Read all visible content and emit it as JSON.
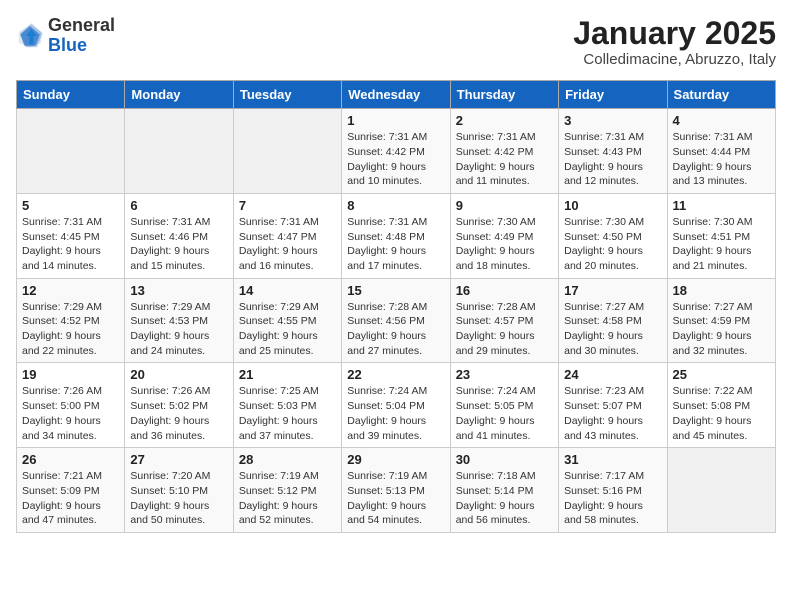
{
  "header": {
    "logo_general": "General",
    "logo_blue": "Blue",
    "title": "January 2025",
    "subtitle": "Colledimacine, Abruzzo, Italy"
  },
  "days_of_week": [
    "Sunday",
    "Monday",
    "Tuesday",
    "Wednesday",
    "Thursday",
    "Friday",
    "Saturday"
  ],
  "weeks": [
    [
      {
        "day": "",
        "info": ""
      },
      {
        "day": "",
        "info": ""
      },
      {
        "day": "",
        "info": ""
      },
      {
        "day": "1",
        "info": "Sunrise: 7:31 AM\nSunset: 4:42 PM\nDaylight: 9 hours\nand 10 minutes."
      },
      {
        "day": "2",
        "info": "Sunrise: 7:31 AM\nSunset: 4:42 PM\nDaylight: 9 hours\nand 11 minutes."
      },
      {
        "day": "3",
        "info": "Sunrise: 7:31 AM\nSunset: 4:43 PM\nDaylight: 9 hours\nand 12 minutes."
      },
      {
        "day": "4",
        "info": "Sunrise: 7:31 AM\nSunset: 4:44 PM\nDaylight: 9 hours\nand 13 minutes."
      }
    ],
    [
      {
        "day": "5",
        "info": "Sunrise: 7:31 AM\nSunset: 4:45 PM\nDaylight: 9 hours\nand 14 minutes."
      },
      {
        "day": "6",
        "info": "Sunrise: 7:31 AM\nSunset: 4:46 PM\nDaylight: 9 hours\nand 15 minutes."
      },
      {
        "day": "7",
        "info": "Sunrise: 7:31 AM\nSunset: 4:47 PM\nDaylight: 9 hours\nand 16 minutes."
      },
      {
        "day": "8",
        "info": "Sunrise: 7:31 AM\nSunset: 4:48 PM\nDaylight: 9 hours\nand 17 minutes."
      },
      {
        "day": "9",
        "info": "Sunrise: 7:30 AM\nSunset: 4:49 PM\nDaylight: 9 hours\nand 18 minutes."
      },
      {
        "day": "10",
        "info": "Sunrise: 7:30 AM\nSunset: 4:50 PM\nDaylight: 9 hours\nand 20 minutes."
      },
      {
        "day": "11",
        "info": "Sunrise: 7:30 AM\nSunset: 4:51 PM\nDaylight: 9 hours\nand 21 minutes."
      }
    ],
    [
      {
        "day": "12",
        "info": "Sunrise: 7:29 AM\nSunset: 4:52 PM\nDaylight: 9 hours\nand 22 minutes."
      },
      {
        "day": "13",
        "info": "Sunrise: 7:29 AM\nSunset: 4:53 PM\nDaylight: 9 hours\nand 24 minutes."
      },
      {
        "day": "14",
        "info": "Sunrise: 7:29 AM\nSunset: 4:55 PM\nDaylight: 9 hours\nand 25 minutes."
      },
      {
        "day": "15",
        "info": "Sunrise: 7:28 AM\nSunset: 4:56 PM\nDaylight: 9 hours\nand 27 minutes."
      },
      {
        "day": "16",
        "info": "Sunrise: 7:28 AM\nSunset: 4:57 PM\nDaylight: 9 hours\nand 29 minutes."
      },
      {
        "day": "17",
        "info": "Sunrise: 7:27 AM\nSunset: 4:58 PM\nDaylight: 9 hours\nand 30 minutes."
      },
      {
        "day": "18",
        "info": "Sunrise: 7:27 AM\nSunset: 4:59 PM\nDaylight: 9 hours\nand 32 minutes."
      }
    ],
    [
      {
        "day": "19",
        "info": "Sunrise: 7:26 AM\nSunset: 5:00 PM\nDaylight: 9 hours\nand 34 minutes."
      },
      {
        "day": "20",
        "info": "Sunrise: 7:26 AM\nSunset: 5:02 PM\nDaylight: 9 hours\nand 36 minutes."
      },
      {
        "day": "21",
        "info": "Sunrise: 7:25 AM\nSunset: 5:03 PM\nDaylight: 9 hours\nand 37 minutes."
      },
      {
        "day": "22",
        "info": "Sunrise: 7:24 AM\nSunset: 5:04 PM\nDaylight: 9 hours\nand 39 minutes."
      },
      {
        "day": "23",
        "info": "Sunrise: 7:24 AM\nSunset: 5:05 PM\nDaylight: 9 hours\nand 41 minutes."
      },
      {
        "day": "24",
        "info": "Sunrise: 7:23 AM\nSunset: 5:07 PM\nDaylight: 9 hours\nand 43 minutes."
      },
      {
        "day": "25",
        "info": "Sunrise: 7:22 AM\nSunset: 5:08 PM\nDaylight: 9 hours\nand 45 minutes."
      }
    ],
    [
      {
        "day": "26",
        "info": "Sunrise: 7:21 AM\nSunset: 5:09 PM\nDaylight: 9 hours\nand 47 minutes."
      },
      {
        "day": "27",
        "info": "Sunrise: 7:20 AM\nSunset: 5:10 PM\nDaylight: 9 hours\nand 50 minutes."
      },
      {
        "day": "28",
        "info": "Sunrise: 7:19 AM\nSunset: 5:12 PM\nDaylight: 9 hours\nand 52 minutes."
      },
      {
        "day": "29",
        "info": "Sunrise: 7:19 AM\nSunset: 5:13 PM\nDaylight: 9 hours\nand 54 minutes."
      },
      {
        "day": "30",
        "info": "Sunrise: 7:18 AM\nSunset: 5:14 PM\nDaylight: 9 hours\nand 56 minutes."
      },
      {
        "day": "31",
        "info": "Sunrise: 7:17 AM\nSunset: 5:16 PM\nDaylight: 9 hours\nand 58 minutes."
      },
      {
        "day": "",
        "info": ""
      }
    ]
  ]
}
